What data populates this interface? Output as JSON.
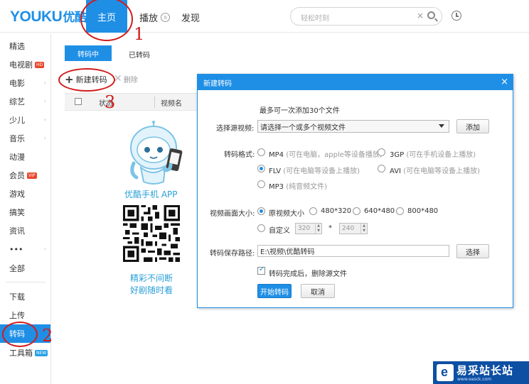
{
  "app": {
    "logo_en": "YOUKU",
    "logo_zh": "优酷"
  },
  "topnav": {
    "home": "主页",
    "play": "播放",
    "discover": "发现"
  },
  "search": {
    "placeholder": "轻松时刻",
    "clear": "×"
  },
  "sidebar": {
    "items": [
      {
        "label": "精选"
      },
      {
        "label": "电视剧",
        "badge": "HD"
      },
      {
        "label": "电影"
      },
      {
        "label": "综艺"
      },
      {
        "label": "少儿"
      },
      {
        "label": "音乐"
      },
      {
        "label": "动漫"
      },
      {
        "label": "会员",
        "badge": "VIP"
      },
      {
        "label": "游戏"
      },
      {
        "label": "搞笑"
      },
      {
        "label": "资讯"
      },
      {
        "label": "•••"
      },
      {
        "label": "全部"
      },
      {
        "label": "下载"
      },
      {
        "label": "上传"
      },
      {
        "label": "转码",
        "active": true
      },
      {
        "label": "工具箱",
        "badge": "NEW"
      }
    ]
  },
  "transcode": {
    "tab_active": "转码中",
    "tab_done": "已转码",
    "new_button": "新建转码",
    "delete_button": "删除",
    "columns": [
      "状态",
      "视频名"
    ],
    "app_title": "优酷手机 APP",
    "tagline1": "精彩不间断",
    "tagline2": "好剧随时看"
  },
  "dialog": {
    "title": "新建转码",
    "close": "×",
    "hint": "最多可一次添加30个文件",
    "source_label": "选择源视频:",
    "source_placeholder": "请选择一个或多个视频文件",
    "add_button": "添加",
    "format_label": "转码格式:",
    "formats": [
      {
        "name": "MP4",
        "note": "(可在电脑，apple等设备播放)"
      },
      {
        "name": "3GP",
        "note": "(可在手机设备上播放)"
      },
      {
        "name": "FLV",
        "note": "(可在电脑等设备上播放)",
        "selected": true
      },
      {
        "name": "AVI",
        "note": "(可在电脑等设备上播放)"
      },
      {
        "name": "MP3",
        "note": "(纯音频文件)"
      }
    ],
    "size_label": "视频画面大小:",
    "sizes": [
      "原视频大小",
      "480*320",
      "640*480",
      "800*480"
    ],
    "size_selected": "原视频大小",
    "custom_label": "自定义",
    "custom_width": "320",
    "custom_height": "240",
    "custom_sep": "*",
    "path_label": "转码保存路径:",
    "path_value": "E:\\视频\\优酷转码",
    "browse_button": "选择",
    "delete_source_label": "转码完成后，删除源文件",
    "delete_source_checked": true,
    "start_button": "开始转码",
    "cancel_button": "取消"
  },
  "annotations": [
    "1",
    "2",
    "3"
  ],
  "watermark": {
    "text": "易采站长站",
    "url": "www.easck.com"
  },
  "colors": {
    "accent": "#1f8fe6",
    "annotation": "#d01c1c",
    "app_text": "#2aa0d8"
  }
}
